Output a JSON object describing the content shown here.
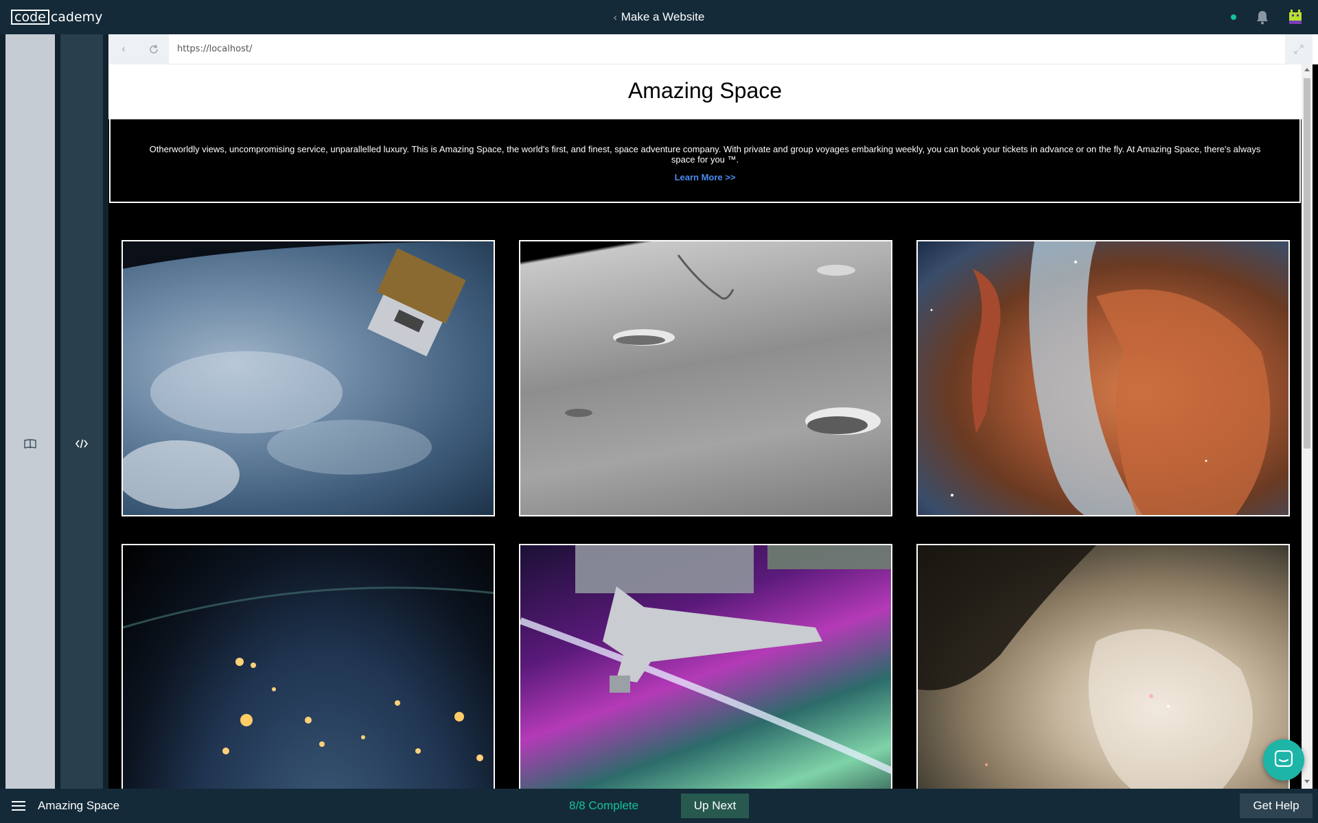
{
  "topbar": {
    "logo_box": "code",
    "logo_rest": "cademy",
    "course_chevron": "‹",
    "course_title": "Make a Website",
    "status_color": "#15c39a",
    "icons": [
      "bell-icon",
      "avatar-icon"
    ]
  },
  "rails": {
    "learn_icon": "book-icon",
    "code_icon": "code-icon"
  },
  "browser": {
    "url": "https://localhost/",
    "back_icon": "‹",
    "reload_icon": "reload-icon",
    "expand_icon": "expand-icon"
  },
  "site": {
    "title": "Amazing Space",
    "hero_text": "Otherworldly views, uncompromising service, unparallelled luxury. This is Amazing Space, the world's first, and finest, space adventure company. With private and group voyages embarking weekly, you can book your tickets in advance or on the fly. At Amazing Space, there's always space for you ™.",
    "learn_more": "Learn More >>",
    "link_color": "#4a8cf1",
    "gallery": [
      {
        "subject": "Earth from orbit with spacecraft"
      },
      {
        "subject": "Lunar surface with craters"
      },
      {
        "subject": "Colorful nebula"
      },
      {
        "subject": "Earth at night city lights"
      },
      {
        "subject": "Robotic arm over aurora"
      },
      {
        "subject": "Orion nebula clouds"
      }
    ]
  },
  "bottombar": {
    "project_name": "Amazing Space",
    "progress": "8/8 Complete",
    "up_next": "Up Next",
    "get_help": "Get Help",
    "accent_color": "#15c39a"
  },
  "chat": {
    "icon": "chat-icon"
  }
}
